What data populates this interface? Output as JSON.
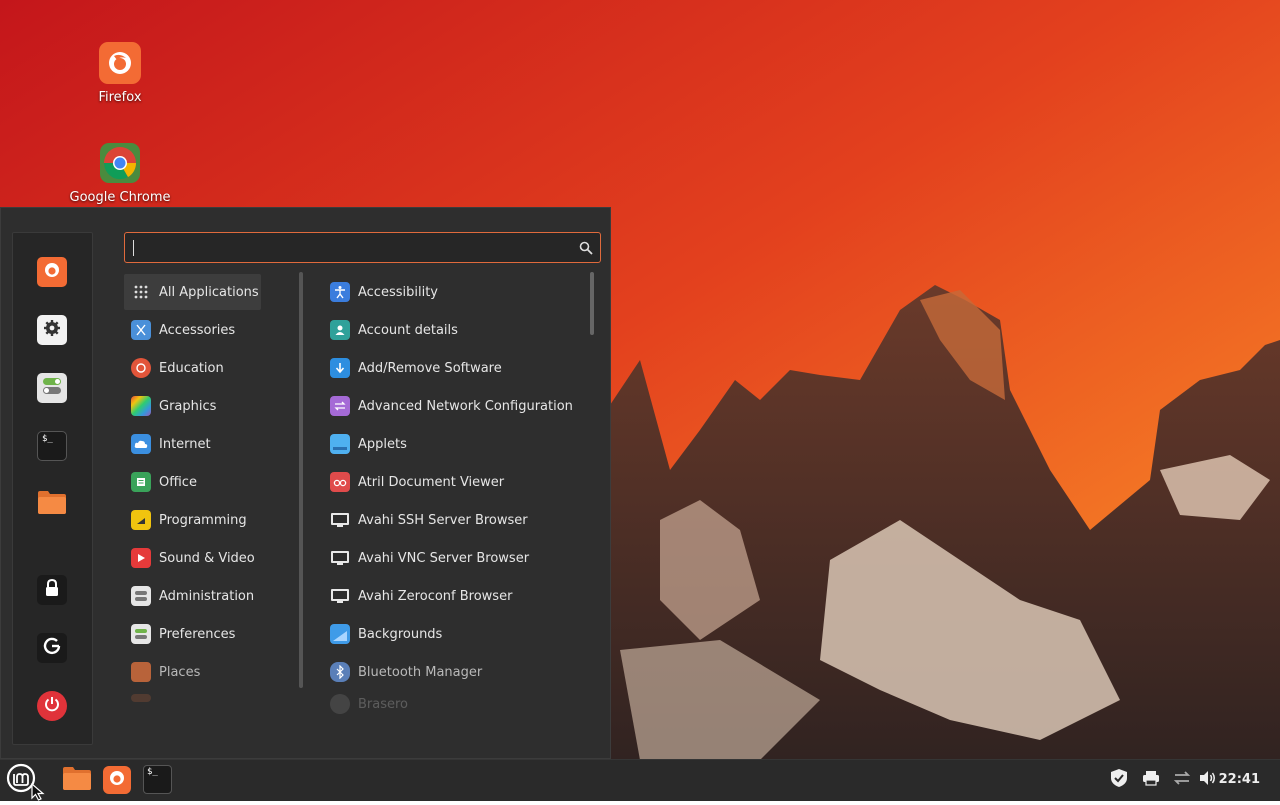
{
  "colors": {
    "accent": "#e06a3c",
    "menu_bg": "#2e2e2e",
    "panel_bg": "#2a2a2a"
  },
  "desktop": {
    "icons": [
      {
        "label": "Firefox",
        "icon": "firefox-icon"
      },
      {
        "label": "Google Chrome",
        "icon": "chrome-icon"
      }
    ]
  },
  "menu": {
    "search": {
      "value": "",
      "placeholder": ""
    },
    "favorites": [
      {
        "icon": "firefox-icon"
      },
      {
        "icon": "settings-icon"
      },
      {
        "icon": "toggles-icon"
      },
      {
        "icon": "terminal-icon"
      },
      {
        "icon": "folder-icon"
      },
      {
        "icon": "lock-icon"
      },
      {
        "icon": "logout-icon"
      },
      {
        "icon": "power-icon"
      }
    ],
    "categories": [
      {
        "label": "All Applications",
        "selected": true
      },
      {
        "label": "Accessories"
      },
      {
        "label": "Education"
      },
      {
        "label": "Graphics"
      },
      {
        "label": "Internet"
      },
      {
        "label": "Office"
      },
      {
        "label": "Programming"
      },
      {
        "label": "Sound & Video"
      },
      {
        "label": "Administration"
      },
      {
        "label": "Preferences"
      },
      {
        "label": "Places"
      }
    ],
    "applications": [
      {
        "label": "Accessibility"
      },
      {
        "label": "Account details"
      },
      {
        "label": "Add/Remove Software"
      },
      {
        "label": "Advanced Network Configuration"
      },
      {
        "label": "Applets"
      },
      {
        "label": "Atril Document Viewer"
      },
      {
        "label": "Avahi SSH Server Browser"
      },
      {
        "label": "Avahi VNC Server Browser"
      },
      {
        "label": "Avahi Zeroconf Browser"
      },
      {
        "label": "Backgrounds"
      },
      {
        "label": "Bluetooth Manager"
      },
      {
        "label": "Brasero"
      }
    ]
  },
  "taskbar": {
    "launchers": [
      {
        "icon": "menu-logo-icon"
      },
      {
        "icon": "folder-icon"
      },
      {
        "icon": "firefox-icon"
      },
      {
        "icon": "terminal-icon"
      }
    ],
    "tray": [
      {
        "icon": "shield-icon"
      },
      {
        "icon": "printer-icon"
      },
      {
        "icon": "network-icon"
      },
      {
        "icon": "volume-icon"
      }
    ],
    "clock": "22:41"
  }
}
